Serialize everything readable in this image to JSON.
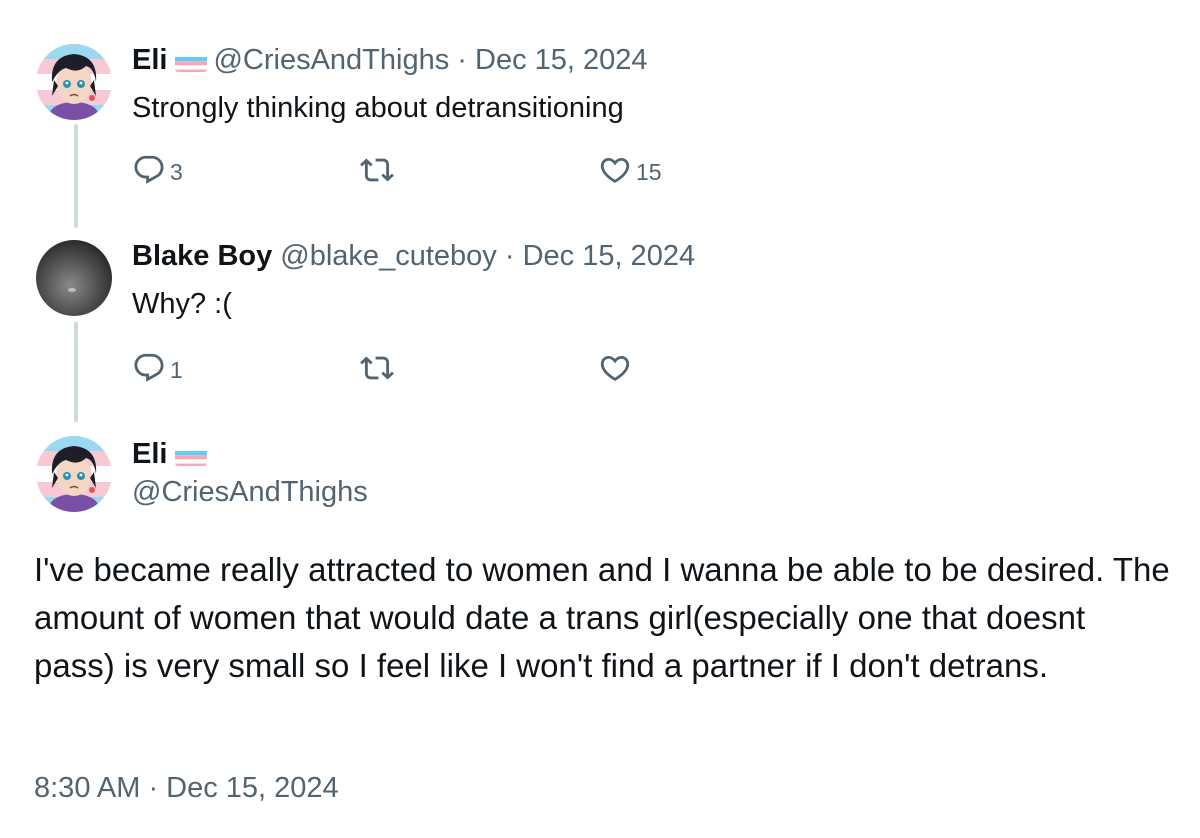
{
  "tweets": [
    {
      "name": "Eli",
      "handle": "@CriesAndThighs",
      "separator": "·",
      "date": "Dec 15, 2024",
      "text": "Strongly thinking about detransitioning",
      "reply_count": "3",
      "like_count": "15"
    },
    {
      "name": "Blake Boy",
      "handle": "@blake_cuteboy",
      "separator": "·",
      "date": "Dec 15, 2024",
      "text": "Why? :(",
      "reply_count": "1",
      "like_count": ""
    }
  ],
  "main_tweet": {
    "name": "Eli",
    "handle": "@CriesAndThighs",
    "text": "I've became really attracted to women and I wanna be able to be desired. The amount of women that would date a trans girl(especially one that doesnt pass) is very small so I feel like I won't find a partner if I don't detrans.",
    "timestamp": "8:30 AM · Dec 15, 2024"
  },
  "icons": {
    "reply": "reply-icon",
    "retweet": "retweet-icon",
    "like": "heart-icon",
    "flag": "trans-flag-icon"
  },
  "colors": {
    "text": "#0f1419",
    "secondary": "#536471",
    "thread_line": "#cfd9de",
    "flag_blue": "#5BCEFA",
    "flag_pink": "#F5A9B8",
    "flag_white": "#FFFFFF"
  }
}
